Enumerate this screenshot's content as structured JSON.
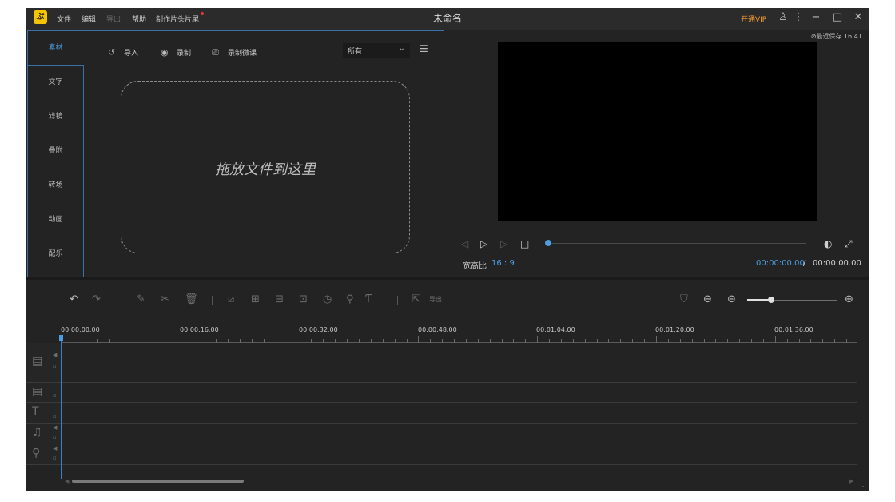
{
  "titlebar": {
    "menus": [
      "文件",
      "编辑",
      "导出",
      "帮助",
      "制作片头片尾"
    ],
    "title": "未命名",
    "vip": "开通VIP"
  },
  "media": {
    "side_tabs": [
      "素材",
      "文字",
      "滤镜",
      "叠附",
      "转场",
      "动画",
      "配乐"
    ],
    "tools": {
      "import": "导入",
      "record": "录制",
      "record_lesson": "录制微课"
    },
    "filter": "所有",
    "drop_text": "拖放文件到这里"
  },
  "preview": {
    "autosave": "最近保存 16:41",
    "ratio_label": "宽高比",
    "ratio_value": "16 : 9",
    "time_current": "00:00:00.00",
    "time_sep": "/",
    "time_total": "00:00:00.00"
  },
  "timeline": {
    "export_label": "导出",
    "ruler": [
      "00:00:00.00",
      "00:00:16.00",
      "00:00:32.00",
      "00:00:48.00",
      "00:01:04.00",
      "00:01:20.00",
      "00:01:36.00"
    ]
  },
  "colors": {
    "accent": "#4d9de0",
    "vip": "#f39c33",
    "logo": "#f5c400",
    "background": "#232323"
  }
}
